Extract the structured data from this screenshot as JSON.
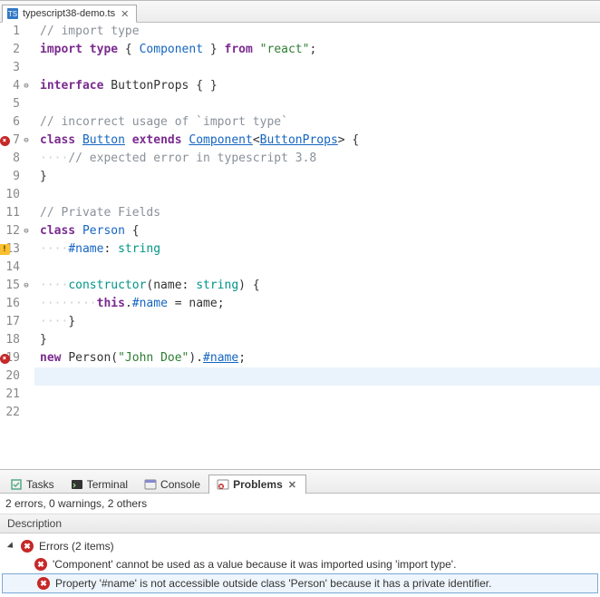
{
  "editor": {
    "tab_filename": "typescript38-demo.ts",
    "lines": [
      {
        "n": 1,
        "marks": [],
        "fold": false,
        "tokens": [
          [
            "comment",
            "// import type"
          ]
        ]
      },
      {
        "n": 2,
        "marks": [],
        "fold": false,
        "tokens": [
          [
            "keyword",
            "import"
          ],
          [
            "punct",
            " "
          ],
          [
            "keyword",
            "type"
          ],
          [
            "punct",
            " { "
          ],
          [
            "type",
            "Component"
          ],
          [
            "punct",
            " } "
          ],
          [
            "keyword",
            "from"
          ],
          [
            "punct",
            " "
          ],
          [
            "string",
            "\"react\""
          ],
          [
            "punct",
            ";"
          ]
        ]
      },
      {
        "n": 3,
        "marks": [],
        "fold": false,
        "tokens": []
      },
      {
        "n": 4,
        "marks": [],
        "fold": true,
        "tokens": [
          [
            "keyword",
            "interface"
          ],
          [
            "punct",
            " "
          ],
          [
            "ident",
            "ButtonProps"
          ],
          [
            "punct",
            " { }"
          ]
        ]
      },
      {
        "n": 5,
        "marks": [],
        "fold": false,
        "tokens": []
      },
      {
        "n": 6,
        "marks": [],
        "fold": false,
        "tokens": [
          [
            "comment",
            "// incorrect usage of `import type`"
          ]
        ]
      },
      {
        "n": 7,
        "marks": [
          "error"
        ],
        "fold": true,
        "tokens": [
          [
            "keyword",
            "class"
          ],
          [
            "punct",
            " "
          ],
          [
            "type underline",
            "Button"
          ],
          [
            "punct",
            " "
          ],
          [
            "keyword",
            "extends"
          ],
          [
            "punct",
            " "
          ],
          [
            "type underline",
            "Component"
          ],
          [
            "punct",
            "<"
          ],
          [
            "type underline",
            "ButtonProps"
          ],
          [
            "punct",
            "> {"
          ]
        ]
      },
      {
        "n": 8,
        "marks": [],
        "fold": false,
        "tokens": [
          [
            "ws",
            "····"
          ],
          [
            "comment",
            "// expected error in typescript 3.8"
          ]
        ]
      },
      {
        "n": 9,
        "marks": [],
        "fold": false,
        "tokens": [
          [
            "punct",
            "}"
          ]
        ]
      },
      {
        "n": 10,
        "marks": [],
        "fold": false,
        "tokens": []
      },
      {
        "n": 11,
        "marks": [],
        "fold": false,
        "tokens": [
          [
            "comment",
            "// Private Fields"
          ]
        ]
      },
      {
        "n": 12,
        "marks": [],
        "fold": true,
        "tokens": [
          [
            "keyword",
            "class"
          ],
          [
            "punct",
            " "
          ],
          [
            "type",
            "Person"
          ],
          [
            "punct",
            " {"
          ]
        ]
      },
      {
        "n": 13,
        "marks": [
          "warn"
        ],
        "fold": false,
        "tokens": [
          [
            "ws",
            "····"
          ],
          [
            "type",
            "#name"
          ],
          [
            "punct",
            ": "
          ],
          [
            "method",
            "string"
          ]
        ]
      },
      {
        "n": 14,
        "marks": [],
        "fold": false,
        "tokens": []
      },
      {
        "n": 15,
        "marks": [],
        "fold": true,
        "tokens": [
          [
            "ws",
            "····"
          ],
          [
            "method",
            "constructor"
          ],
          [
            "punct",
            "("
          ],
          [
            "ident",
            "name"
          ],
          [
            "punct",
            ": "
          ],
          [
            "method",
            "string"
          ],
          [
            "punct",
            ") {"
          ]
        ]
      },
      {
        "n": 16,
        "marks": [],
        "fold": false,
        "tokens": [
          [
            "ws",
            "········"
          ],
          [
            "keyword",
            "this"
          ],
          [
            "punct",
            "."
          ],
          [
            "type",
            "#name"
          ],
          [
            "punct",
            " = name;"
          ]
        ]
      },
      {
        "n": 17,
        "marks": [],
        "fold": false,
        "tokens": [
          [
            "ws",
            "····"
          ],
          [
            "punct",
            "}"
          ]
        ]
      },
      {
        "n": 18,
        "marks": [],
        "fold": false,
        "tokens": [
          [
            "punct",
            "}"
          ]
        ]
      },
      {
        "n": 19,
        "marks": [
          "error"
        ],
        "fold": false,
        "tokens": [
          [
            "keyword",
            "new"
          ],
          [
            "punct",
            " "
          ],
          [
            "ident",
            "Person"
          ],
          [
            "punct",
            "("
          ],
          [
            "string",
            "\"John Doe\""
          ],
          [
            "punct",
            ")."
          ],
          [
            "type underline",
            "#name"
          ],
          [
            "punct",
            ";"
          ]
        ]
      },
      {
        "n": 20,
        "marks": [],
        "fold": false,
        "hl": true,
        "tokens": []
      },
      {
        "n": 21,
        "marks": [],
        "fold": false,
        "tokens": []
      },
      {
        "n": 22,
        "marks": [],
        "fold": false,
        "tokens": []
      }
    ]
  },
  "views": {
    "tabs": [
      {
        "id": "tasks",
        "label": "Tasks",
        "icon": "tasks-icon"
      },
      {
        "id": "terminal",
        "label": "Terminal",
        "icon": "terminal-icon"
      },
      {
        "id": "console",
        "label": "Console",
        "icon": "console-icon"
      },
      {
        "id": "problems",
        "label": "Problems",
        "icon": "problems-icon",
        "active": true,
        "closable": true
      }
    ]
  },
  "problems": {
    "summary": "2 errors, 0 warnings, 2 others",
    "column_header": "Description",
    "group_label": "Errors (2 items)",
    "items": [
      "'Component' cannot be used as a value because it was imported using 'import type'.",
      "Property '#name' is not accessible outside class 'Person' because it has a private identifier."
    ]
  }
}
